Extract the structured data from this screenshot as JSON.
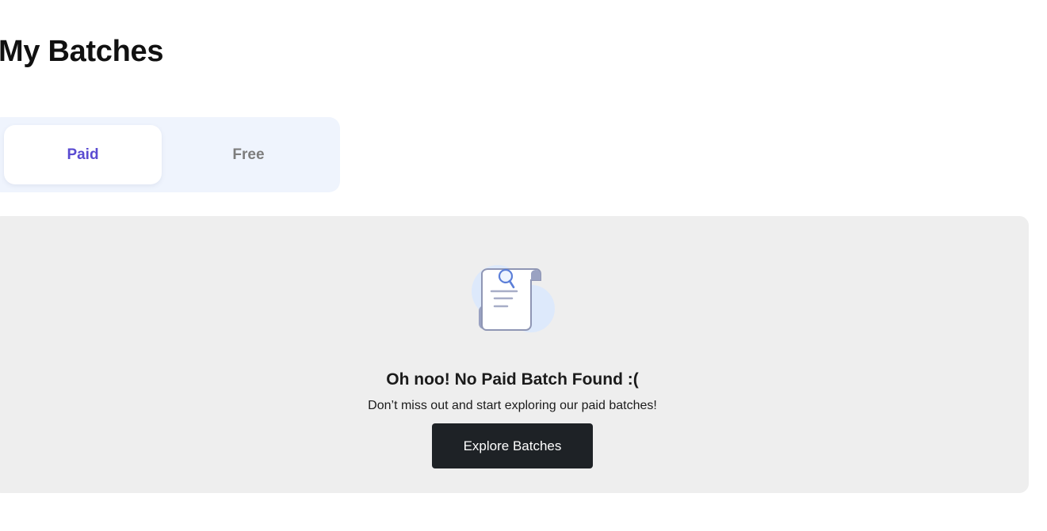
{
  "page": {
    "title": "My Batches"
  },
  "tabs": [
    {
      "label": "Paid",
      "active": true
    },
    {
      "label": "Free",
      "active": false
    }
  ],
  "empty_state": {
    "icon": "document-search-icon",
    "title": "Oh noo! No Paid Batch Found :(",
    "subtitle": "Don’t miss out and start exploring our paid batches!",
    "button_label": "Explore Batches"
  },
  "colors": {
    "active_tab_text": "#5a4bd1",
    "inactive_tab_text": "#7d7d7d",
    "tabs_background": "#eff4fd",
    "panel_background": "#eeeeee",
    "button_background": "#1e2226"
  }
}
